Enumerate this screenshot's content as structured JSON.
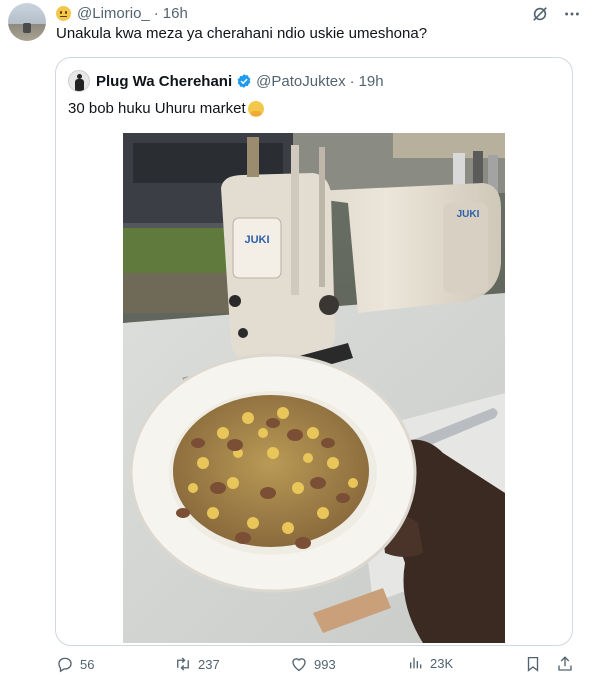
{
  "tweet": {
    "handle": "@Limorio_",
    "time": "16h",
    "text": "Unakula kwa meza ya cherahani ndio uskie umeshona?"
  },
  "quote": {
    "name": "Plug Wa Cherehani",
    "handle": "@PatoJuktex",
    "time": "19h",
    "text": "30 bob huku Uhuru market",
    "photo": {
      "brand_label": "JUKI"
    }
  },
  "actions": {
    "replies": "56",
    "retweets": "237",
    "likes": "993",
    "views": "23K"
  },
  "colors": {
    "text": "#0f1419",
    "muted": "#536471",
    "border": "#cfd9de",
    "verified": "#1d9bf0"
  },
  "icons": [
    "grok-icon",
    "more-icon",
    "verified-icon",
    "reply-icon",
    "retweet-icon",
    "like-icon",
    "views-icon",
    "bookmark-icon",
    "share-icon"
  ]
}
